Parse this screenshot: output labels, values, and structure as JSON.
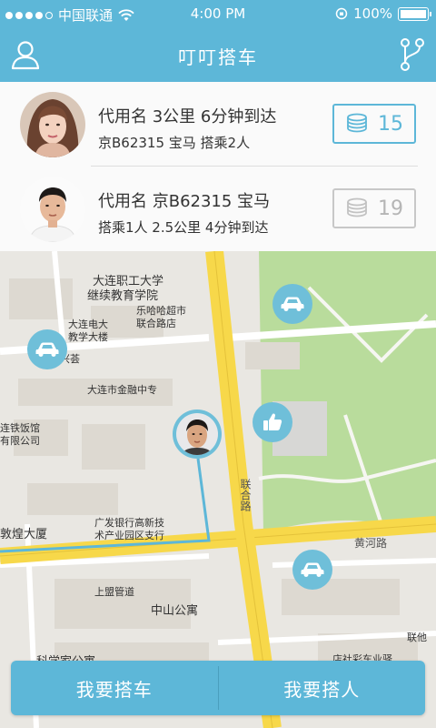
{
  "status_bar": {
    "carrier": "中国联通",
    "time": "4:00 PM",
    "battery": "100%",
    "signal_bars_filled": 4,
    "signal_bars_total": 5
  },
  "navbar": {
    "title": "叮叮搭车",
    "left_icon": "user-icon",
    "right_icon": "branch-icon"
  },
  "drivers": [
    {
      "line1": "代用名 3公里 6分钟到达",
      "line2": "京B62315 宝马 搭乘2人",
      "coins": "15",
      "highlighted": true
    },
    {
      "line1": "代用名 京B62315 宝马",
      "line2": "搭乘1人 2.5公里 4分钟到达",
      "coins": "19",
      "highlighted": false
    }
  ],
  "map": {
    "labels": {
      "dalian_vocational": "大连职工大学",
      "continuing_edu": "继续教育学院",
      "dalian_tv_univ": "大连电大",
      "teaching_building": "教学大楼",
      "lehaha_market": "乐哈哈超市",
      "joint_store": "联合路店",
      "xinghui": "兴荟",
      "finance_school": "大连市金融中专",
      "tiezhen": "连铁饭馆",
      "youxian": "有限公司",
      "lianhe_road": "联合路",
      "huanghe_road": "黄河路",
      "gdb_bank": "广发银行高新技",
      "gdb_bank2": "术产业园区支行",
      "dasha": "敦煌大厦",
      "shangmeng": "上盟管道",
      "zhongshan": "中山公寓",
      "kexue": "科学家公寓",
      "lianhe_short": "联他",
      "bottom_right": "店社彩车业驿"
    }
  },
  "bottom_buttons": {
    "left": "我要搭车",
    "right": "我要搭人"
  },
  "colors": {
    "primary": "#5db7d8",
    "pin": "#6fbfd9",
    "road_major": "#f7d84a",
    "park": "#b9dc9c"
  }
}
